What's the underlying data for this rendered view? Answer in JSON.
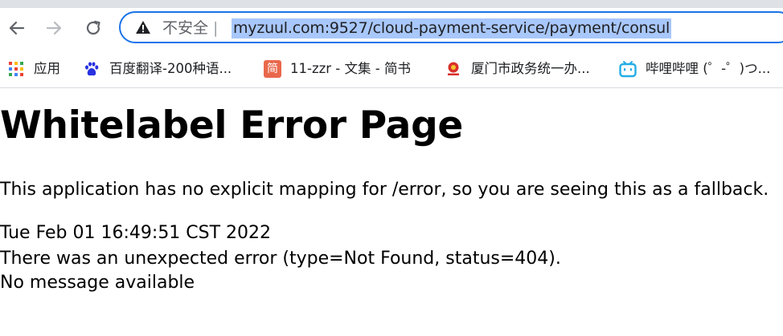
{
  "browser": {
    "security_label": "不安全",
    "separator": "|",
    "url": "myzuul.com:9527/cloud-payment-service/payment/consul",
    "bookmarks": [
      {
        "icon": "apps-grid-icon",
        "label": "应用"
      },
      {
        "icon": "baidu-paw-icon",
        "label": "百度翻译-200种语..."
      },
      {
        "icon": "jianshu-icon",
        "label": "11-zzr - 文集 - 简书",
        "icon_text": "简"
      },
      {
        "icon": "government-emblem-icon",
        "label": "厦门市政务统一办..."
      },
      {
        "icon": "bilibili-tv-icon",
        "label": "哔哩哔哩 (゜-゜)つ..."
      }
    ],
    "colors": {
      "accent": "#1a73e8",
      "url_selection": "#a8c7fa",
      "jianshu": "#e9684c",
      "bilibili": "#23ade5"
    }
  },
  "page": {
    "title": "Whitelabel Error Page",
    "description": "This application has no explicit mapping for /error, so you are seeing this as a fallback.",
    "timestamp": "Tue Feb 01 16:49:51 CST 2022",
    "error": "There was an unexpected error (type=Not Found, status=404).",
    "message": "No message available"
  }
}
